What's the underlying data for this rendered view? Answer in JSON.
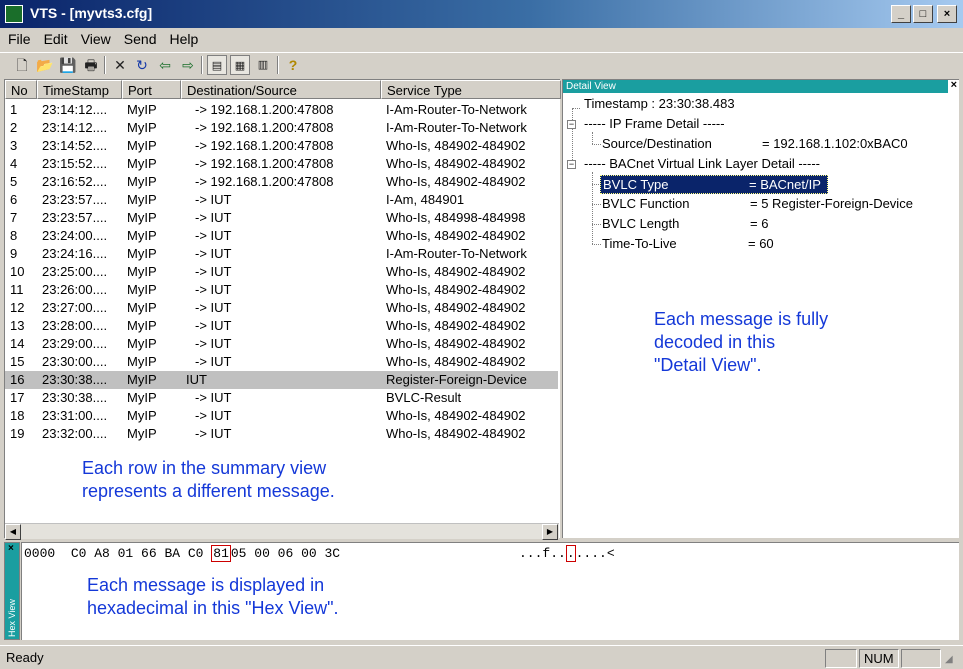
{
  "window": {
    "title": "VTS - [myvts3.cfg]",
    "minimize": "_",
    "maximize": "□",
    "close": "×"
  },
  "menu": [
    "File",
    "Edit",
    "View",
    "Send",
    "Help"
  ],
  "toolbar": [
    "new-icon",
    "open-icon",
    "save-icon",
    "print-icon",
    "delete-icon",
    "refresh-icon",
    "back-icon",
    "forward-icon",
    "summary-view-icon",
    "detail-view-icon",
    "hex-view-icon",
    "help-icon"
  ],
  "summary": {
    "columns": [
      "No",
      "TimeStamp",
      "Port",
      "Destination/Source",
      "Service Type"
    ],
    "selected_row": 16,
    "rows": [
      {
        "no": "1",
        "time": "23:14:12....",
        "port": "MyIP",
        "dest": "-> 192.168.1.200:47808",
        "service": "I-Am-Router-To-Network"
      },
      {
        "no": "2",
        "time": "23:14:12....",
        "port": "MyIP",
        "dest": "-> 192.168.1.200:47808",
        "service": "I-Am-Router-To-Network"
      },
      {
        "no": "3",
        "time": "23:14:52....",
        "port": "MyIP",
        "dest": "-> 192.168.1.200:47808",
        "service": "Who-Is, 484902-484902"
      },
      {
        "no": "4",
        "time": "23:15:52....",
        "port": "MyIP",
        "dest": "-> 192.168.1.200:47808",
        "service": "Who-Is, 484902-484902"
      },
      {
        "no": "5",
        "time": "23:16:52....",
        "port": "MyIP",
        "dest": "-> 192.168.1.200:47808",
        "service": "Who-Is, 484902-484902"
      },
      {
        "no": "6",
        "time": "23:23:57....",
        "port": "MyIP",
        "dest": "-> IUT",
        "service": "I-Am, 484901"
      },
      {
        "no": "7",
        "time": "23:23:57....",
        "port": "MyIP",
        "dest": "-> IUT",
        "service": "Who-Is, 484998-484998"
      },
      {
        "no": "8",
        "time": "23:24:00....",
        "port": "MyIP",
        "dest": "-> IUT",
        "service": "Who-Is, 484902-484902"
      },
      {
        "no": "9",
        "time": "23:24:16....",
        "port": "MyIP",
        "dest": "-> IUT",
        "service": "I-Am-Router-To-Network"
      },
      {
        "no": "10",
        "time": "23:25:00....",
        "port": "MyIP",
        "dest": "-> IUT",
        "service": "Who-Is, 484902-484902"
      },
      {
        "no": "11",
        "time": "23:26:00....",
        "port": "MyIP",
        "dest": "-> IUT",
        "service": "Who-Is, 484902-484902"
      },
      {
        "no": "12",
        "time": "23:27:00....",
        "port": "MyIP",
        "dest": "-> IUT",
        "service": "Who-Is, 484902-484902"
      },
      {
        "no": "13",
        "time": "23:28:00....",
        "port": "MyIP",
        "dest": "-> IUT",
        "service": "Who-Is, 484902-484902"
      },
      {
        "no": "14",
        "time": "23:29:00....",
        "port": "MyIP",
        "dest": "-> IUT",
        "service": "Who-Is, 484902-484902"
      },
      {
        "no": "15",
        "time": "23:30:00....",
        "port": "MyIP",
        "dest": "-> IUT",
        "service": "Who-Is, 484902-484902"
      },
      {
        "no": "16",
        "time": "23:30:38....",
        "port": "MyIP",
        "dest": "IUT",
        "service": "Register-Foreign-Device"
      },
      {
        "no": "17",
        "time": "23:30:38....",
        "port": "MyIP",
        "dest": "-> IUT",
        "service": "BVLC-Result"
      },
      {
        "no": "18",
        "time": "23:31:00....",
        "port": "MyIP",
        "dest": "-> IUT",
        "service": "Who-Is, 484902-484902"
      },
      {
        "no": "19",
        "time": "23:32:00....",
        "port": "MyIP",
        "dest": "-> IUT",
        "service": "Who-Is, 484902-484902"
      }
    ],
    "annotation": [
      "Each row in the summary view",
      "represents a different message."
    ]
  },
  "detail": {
    "title": "Detail View",
    "close": "×",
    "timestamp": "Timestamp : 23:30:38.483",
    "ip_frame": "----- IP Frame Detail -----",
    "source_dest_label": "Source/Destination",
    "source_dest_value": "= 192.168.1.102:0xBAC0",
    "bvll": "----- BACnet Virtual Link Layer Detail -----",
    "bvlc_type_label": "BVLC Type",
    "bvlc_type_value": "= BACnet/IP",
    "bvlc_function_label": "BVLC Function",
    "bvlc_function_value": "= 5  Register-Foreign-Device",
    "bvlc_length_label": "BVLC Length",
    "bvlc_length_value": "= 6",
    "ttl_label": "Time-To-Live",
    "ttl_value": "= 60",
    "annotation": [
      "Each message is fully",
      "decoded in this",
      "\"Detail View\"."
    ]
  },
  "hex": {
    "title": "Hex View",
    "close": "×",
    "offset": "0000",
    "bytes_before": "C0 A8 01 66 BA C0",
    "highlighted_byte": "81",
    "bytes_after": "05 00 06 00 3C",
    "ascii_before": "...f..",
    "ascii_highlight": ".",
    "ascii_after": "....<",
    "highlight_color": "#cc0000",
    "annotation": [
      "Each message is displayed in",
      "hexadecimal in this \"Hex View\"."
    ]
  },
  "status": {
    "text": "Ready",
    "num": "NUM"
  },
  "colors": {
    "title_bar": "#0a246a",
    "pane_title": "#1a9ea0",
    "selection": "#c0c0c0",
    "detail_selection": "#0a246a",
    "annotation": "#1438d8"
  }
}
